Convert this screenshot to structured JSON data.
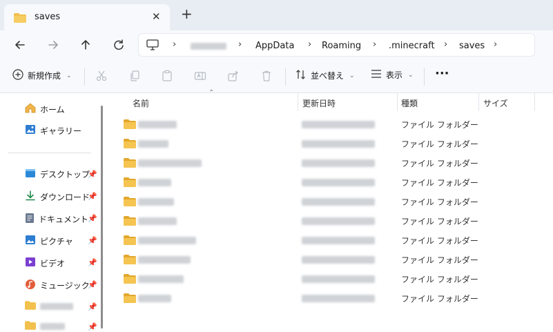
{
  "window": {
    "tab_title": "saves",
    "tab_close_icon": "close-icon",
    "new_tab_icon": "plus-icon"
  },
  "navigation": {
    "back_icon": "arrow-left-icon",
    "forward_icon": "arrow-right-icon",
    "up_icon": "arrow-up-icon",
    "refresh_icon": "refresh-icon",
    "breadcrumbs": [
      "AppData",
      "Roaming",
      ".minecraft",
      "saves"
    ]
  },
  "toolbar": {
    "new_label": "新規作成",
    "sort_label": "並べ替え",
    "view_label": "表示",
    "more_label": "···"
  },
  "sidebar": {
    "home": "ホーム",
    "gallery": "ギャラリー",
    "pinned": [
      {
        "label": "デスクトップ",
        "icon": "desktop-icon",
        "color": "#2b88d8"
      },
      {
        "label": "ダウンロード",
        "icon": "download-icon",
        "color": "#1f8a4c"
      },
      {
        "label": "ドキュメント",
        "icon": "document-icon",
        "color": "#6b7a90"
      },
      {
        "label": "ピクチャ",
        "icon": "pictures-icon",
        "color": "#2d7dd2"
      },
      {
        "label": "ビデオ",
        "icon": "video-icon",
        "color": "#7b3fd1"
      },
      {
        "label": "ミュージック",
        "icon": "music-icon",
        "color": "#e35d3a"
      }
    ],
    "pin_glyph": "📌"
  },
  "columns": {
    "name": "名前",
    "date": "更新日時",
    "type": "種類",
    "size": "サイズ"
  },
  "files": [
    {
      "type": "ファイル フォルダー"
    },
    {
      "type": "ファイル フォルダー"
    },
    {
      "type": "ファイル フォルダー"
    },
    {
      "type": "ファイル フォルダー"
    },
    {
      "type": "ファイル フォルダー"
    },
    {
      "type": "ファイル フォルダー"
    },
    {
      "type": "ファイル フォルダー"
    },
    {
      "type": "ファイル フォルダー"
    },
    {
      "type": "ファイル フォルダー"
    },
    {
      "type": "ファイル フォルダー"
    }
  ],
  "colors": {
    "folder": "#f2c04d",
    "folder_dark": "#e2a72c",
    "accent": "#0067c0"
  }
}
